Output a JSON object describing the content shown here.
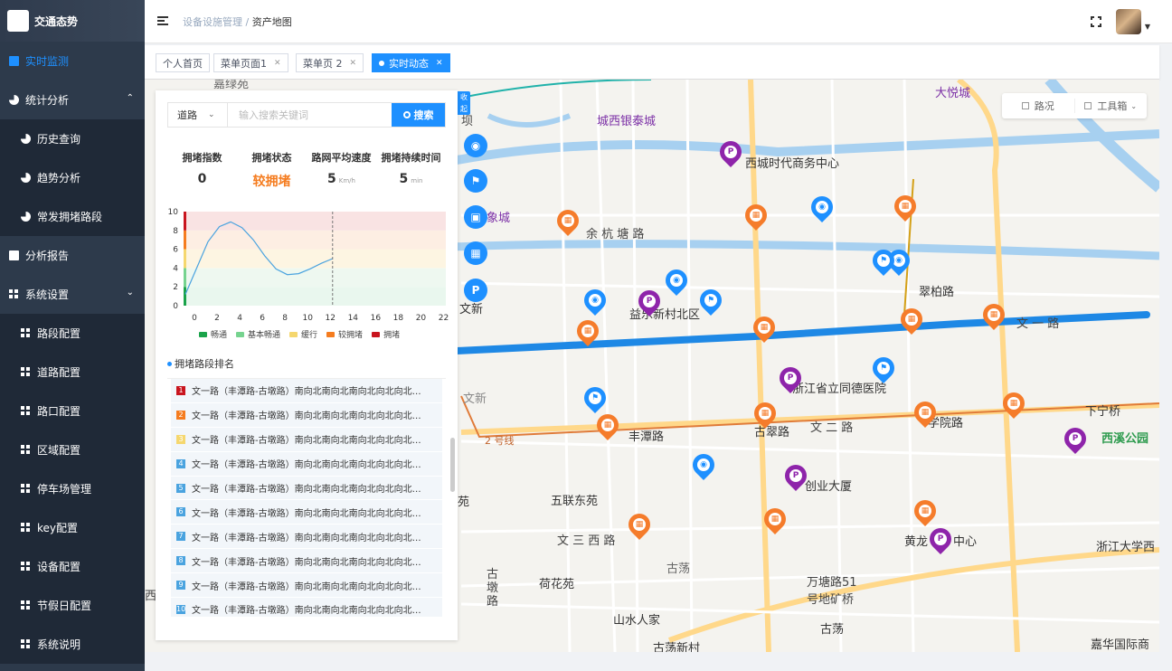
{
  "app": {
    "title": "交通态势"
  },
  "sidebar": {
    "items": [
      {
        "label": "实时监测"
      },
      {
        "label": "统计分析"
      },
      {
        "label": "历史查询"
      },
      {
        "label": "趋势分析"
      },
      {
        "label": "常发拥堵路段"
      },
      {
        "label": "分析报告"
      },
      {
        "label": "系统设置"
      },
      {
        "label": "路段配置"
      },
      {
        "label": "道路配置"
      },
      {
        "label": "路口配置"
      },
      {
        "label": "区域配置"
      },
      {
        "label": "停车场管理"
      },
      {
        "label": "key配置"
      },
      {
        "label": "设备配置"
      },
      {
        "label": "节假日配置"
      },
      {
        "label": "系统说明"
      }
    ]
  },
  "header": {
    "breadcrumb_parent": "设备设施管理",
    "breadcrumb_sep": "/",
    "breadcrumb_current": "资产地图"
  },
  "tags": [
    {
      "label": "个人首页"
    },
    {
      "label": "菜单页面1"
    },
    {
      "label": "菜单页 2"
    },
    {
      "label": "实时动态"
    }
  ],
  "toolbox": {
    "road": "路况",
    "tools": "工具箱"
  },
  "collapse_label": "收起",
  "search": {
    "type": "道路",
    "placeholder": "输入搜索关键词",
    "button": "搜索"
  },
  "stats": [
    {
      "label": "拥堵指数",
      "value": "0",
      "unit": ""
    },
    {
      "label": "拥堵状态",
      "value": "较拥堵",
      "unit": ""
    },
    {
      "label": "路网平均速度",
      "value": "5",
      "unit": "Km/h"
    },
    {
      "label": "拥堵持续时间",
      "value": "5",
      "unit": "min"
    }
  ],
  "chart_data": {
    "type": "line",
    "x_ticks": [
      0,
      2,
      4,
      6,
      8,
      10,
      12,
      14,
      16,
      18,
      20,
      22
    ],
    "y_ticks": [
      0,
      2,
      4,
      6,
      8,
      10
    ],
    "ylim": [
      0,
      10
    ],
    "xlim": [
      0,
      23
    ],
    "series": [
      {
        "x": [
          0,
          1,
          2,
          3,
          4,
          5,
          6,
          7,
          8,
          9,
          10,
          11,
          12,
          13
        ],
        "values": [
          1.2,
          4.0,
          6.8,
          8.4,
          8.9,
          8.3,
          7.0,
          5.3,
          3.9,
          3.3,
          3.4,
          3.9,
          4.5,
          5.0
        ]
      }
    ],
    "marker_x": 13,
    "bands": [
      {
        "name": "畅通",
        "range": [
          0,
          2
        ],
        "color": "#1aa34a"
      },
      {
        "name": "基本畅通",
        "range": [
          2,
          4
        ],
        "color": "#76d38f"
      },
      {
        "name": "缓行",
        "range": [
          4,
          6
        ],
        "color": "#f5d76e"
      },
      {
        "name": "较拥堵",
        "range": [
          6,
          8
        ],
        "color": "#f57c1f"
      },
      {
        "name": "拥堵",
        "range": [
          8,
          10
        ],
        "color": "#c9151e"
      }
    ]
  },
  "rank_title": "拥堵路段排名",
  "rank_rows": [
    {
      "num": "1",
      "color": "#c9151e",
      "text": "文一路（丰潭路-古墩路）南向北南向北南向北向北向北向北向..."
    },
    {
      "num": "2",
      "color": "#f57c1f",
      "text": "文一路（丰潭路-古墩路）南向北南向北南向北向北向北向北向..."
    },
    {
      "num": "3",
      "color": "#f5d76e",
      "text": "文一路（丰潭路-古墩路）南向北南向北南向北向北向北向北向..."
    },
    {
      "num": "4",
      "color": "#4aa3df",
      "text": "文一路（丰潭路-古墩路）南向北南向北南向北向北向北向北向..."
    },
    {
      "num": "5",
      "color": "#4aa3df",
      "text": "文一路（丰潭路-古墩路）南向北南向北南向北向北向北向北向..."
    },
    {
      "num": "6",
      "color": "#4aa3df",
      "text": "文一路（丰潭路-古墩路）南向北南向北南向北向北向北向北向..."
    },
    {
      "num": "7",
      "color": "#4aa3df",
      "text": "文一路（丰潭路-古墩路）南向北南向北南向北向北向北向北向..."
    },
    {
      "num": "8",
      "color": "#4aa3df",
      "text": "文一路（丰潭路-古墩路）南向北南向北南向北向北向北向北向..."
    },
    {
      "num": "9",
      "color": "#4aa3df",
      "text": "文一路（丰潭路-古墩路）南向北南向北南向北向北向北向北向..."
    },
    {
      "num": "10",
      "color": "#4aa3df",
      "text": "文一路（丰潭路-古墩路）南向北南向北南向北向北向北向北向..."
    }
  ],
  "map": {
    "places": [
      {
        "text": "大悦城",
        "cls": "purple"
      },
      {
        "text": "城西银泰城",
        "cls": "purple"
      },
      {
        "text": "西城时代商务中心",
        "cls": ""
      },
      {
        "text": "余 杭 塘 路",
        "cls": ""
      },
      {
        "text": "象城",
        "cls": "purple"
      },
      {
        "text": "翠柏路",
        "cls": ""
      },
      {
        "text": "益乐新村北区",
        "cls": ""
      },
      {
        "text": "文新",
        "cls": ""
      },
      {
        "text": "文 一 路",
        "cls": ""
      },
      {
        "text": "浙江省立同德医院",
        "cls": ""
      },
      {
        "text": "文新",
        "cls": ""
      },
      {
        "text": "下宁桥",
        "cls": ""
      },
      {
        "text": "丰潭路",
        "cls": ""
      },
      {
        "text": "古翠路",
        "cls": ""
      },
      {
        "text": "文 二 路",
        "cls": ""
      },
      {
        "text": "学院路",
        "cls": ""
      },
      {
        "text": "西溪公园",
        "cls": "green"
      },
      {
        "text": "2 号线",
        "cls": ""
      },
      {
        "text": "创业大厦",
        "cls": ""
      },
      {
        "text": "五联东苑",
        "cls": ""
      },
      {
        "text": "文 三 西 路",
        "cls": ""
      },
      {
        "text": "古荡",
        "cls": ""
      },
      {
        "text": "黄龙",
        "cls": ""
      },
      {
        "text": "中心",
        "cls": ""
      },
      {
        "text": "浙江大学西",
        "cls": ""
      },
      {
        "text": "荷花苑",
        "cls": ""
      },
      {
        "text": "万塘路51",
        "cls": ""
      },
      {
        "text": "号地矿桥",
        "cls": ""
      },
      {
        "text": "古墩路",
        "cls": ""
      },
      {
        "text": "山水人家",
        "cls": ""
      },
      {
        "text": "古荡",
        "cls": ""
      },
      {
        "text": "古荡新村",
        "cls": ""
      },
      {
        "text": "嘉华国际商",
        "cls": ""
      },
      {
        "text": "苑",
        "cls": ""
      },
      {
        "text": "西溪",
        "cls": ""
      },
      {
        "text": "嘉绿苑",
        "cls": ""
      },
      {
        "text": "坝",
        "cls": ""
      }
    ]
  }
}
